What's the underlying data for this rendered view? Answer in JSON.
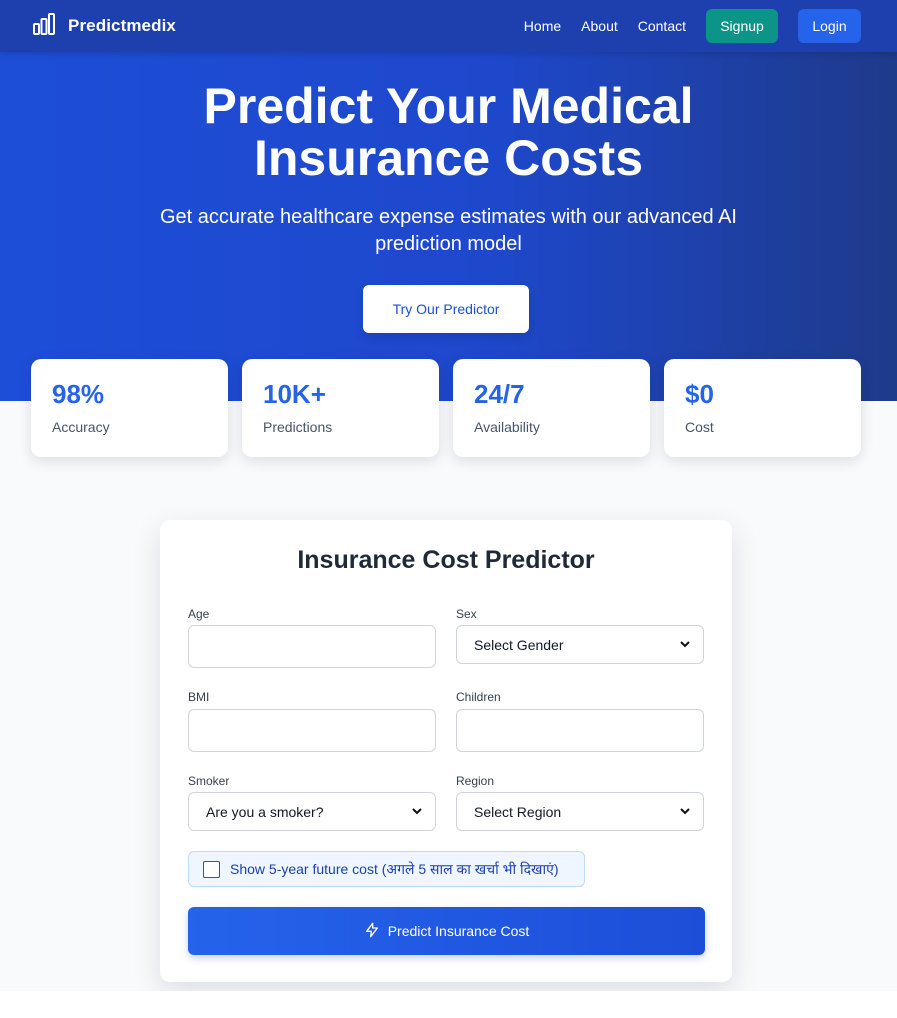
{
  "nav": {
    "brand": "Predictmedix",
    "links": [
      "Home",
      "About",
      "Contact"
    ],
    "signup": "Signup",
    "login": "Login"
  },
  "hero": {
    "title_line1": "Predict Your Medical",
    "title_line2": "Insurance Costs",
    "subtitle_line1": "Get accurate healthcare expense estimates with our advanced AI",
    "subtitle_line2": "prediction model",
    "cta": "Try Our Predictor"
  },
  "stats": [
    {
      "value": "98%",
      "label": "Accuracy"
    },
    {
      "value": "10K+",
      "label": "Predictions"
    },
    {
      "value": "24/7",
      "label": "Availability"
    },
    {
      "value": "$0",
      "label": "Cost"
    }
  ],
  "form": {
    "title": "Insurance Cost Predictor",
    "age_label": "Age",
    "sex_label": "Sex",
    "sex_value": "Select Gender",
    "bmi_label": "BMI",
    "children_label": "Children",
    "smoker_label": "Smoker",
    "smoker_value": "Are you a smoker?",
    "region_label": "Region",
    "region_value": "Select Region",
    "future_cost_label": "Show 5-year future cost (अगले 5 साल का खर्चा भी दिखाएं)",
    "submit": "Predict Insurance Cost"
  },
  "colors": {
    "primary": "#2563eb",
    "nav_bg": "#1e40af",
    "signup": "#0d9488"
  },
  "icons": {
    "logo": "bar-chart-icon",
    "chevron": "chevron-down-icon",
    "predict": "lightning-icon"
  }
}
